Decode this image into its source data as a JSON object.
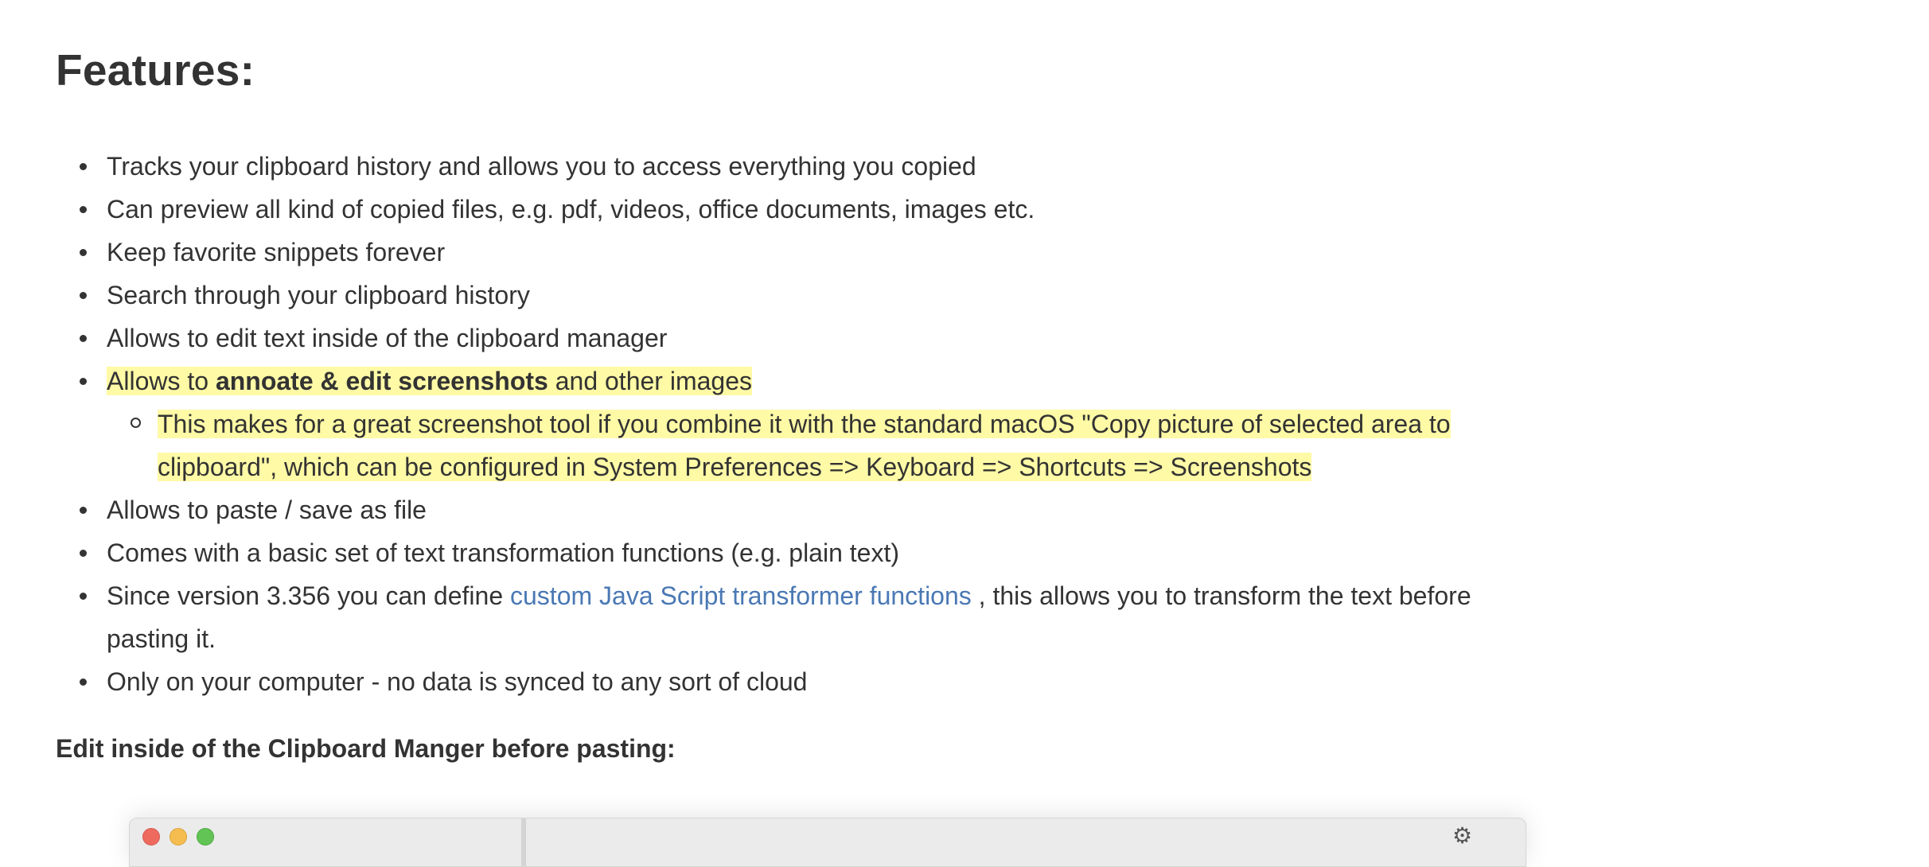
{
  "heading": "Features:",
  "features": {
    "item1": "Tracks your clipboard history and allows you to access everything you copied",
    "item2": "Can preview all kind of copied files, e.g. pdf, videos, office documents, images etc.",
    "item3": "Keep favorite snippets forever",
    "item4": "Search through your clipboard history",
    "item5": "Allows to edit text inside of the clipboard manager",
    "item6": {
      "prefix": "Allows to ",
      "bold": "annoate & edit screenshots",
      "suffix": " and other images",
      "sub": {
        "line1": "This makes for a great screenshot tool if you combine it with the standard macOS \"Copy picture of selected area to",
        "line2": "clipboard\", which can be configured in System Preferences => Keyboard => Shortcuts => Screenshots"
      }
    },
    "item7": "Allows to paste / save as file",
    "item8": "Comes with a basic set of text transformation functions (e.g. plain text)",
    "item9": {
      "prefix": "Since version 3.356 you can define ",
      "link": "custom Java Script transformer functions",
      "suffix_line1": " , this allows you to transform the text before",
      "suffix_line2": "pasting it."
    },
    "item10": "Only on your computer - no data is synced to any sort of cloud"
  },
  "section_heading": "Edit inside of the Clipboard Manger before pasting:",
  "colors": {
    "text": "#333333",
    "highlight": "#fffaa6",
    "link": "#4a78b4"
  },
  "icons": {
    "window_close": "close-button-icon",
    "window_minimize": "minimize-button-icon",
    "window_maximize": "maximize-button-icon",
    "settings": "gear-icon"
  }
}
